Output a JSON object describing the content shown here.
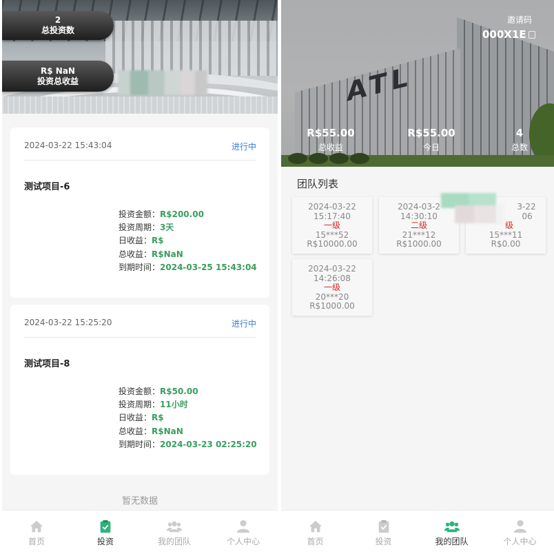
{
  "invest_screen": {
    "summary": {
      "count_value": "2",
      "count_label": "总投资数",
      "income_value": "R$ NaN",
      "income_label": "投资总收益"
    },
    "investments": [
      {
        "time": "2024-03-22 15:43:04",
        "status": "进行中",
        "title": "测试项目-6",
        "rows": [
          {
            "label": "投资金额：",
            "value": "R$200.00"
          },
          {
            "label": "投资周期：",
            "value": "3天"
          },
          {
            "label": "日收益：",
            "value": "R$"
          },
          {
            "label": "总收益：",
            "value": "R$NaN"
          },
          {
            "label": "到期时间：",
            "value": "2024-03-25 15:43:04"
          }
        ]
      },
      {
        "time": "2024-03-22 15:25:20",
        "status": "进行中",
        "title": "测试项目-8",
        "rows": [
          {
            "label": "投资金额：",
            "value": "R$50.00"
          },
          {
            "label": "投资周期：",
            "value": "11小时"
          },
          {
            "label": "日收益：",
            "value": "R$"
          },
          {
            "label": "总收益：",
            "value": "R$NaN"
          },
          {
            "label": "到期时间：",
            "value": "2024-03-23 02:25:20"
          }
        ]
      }
    ],
    "empty_text": "暂无数据"
  },
  "team_screen": {
    "invite": {
      "label": "邀请码",
      "code": "000X1E"
    },
    "stats": [
      {
        "value": "R$55.00",
        "label": "总收益"
      },
      {
        "value": "R$55.00",
        "label": "今日"
      },
      {
        "value": "4",
        "label": "总数"
      }
    ],
    "list_title": "团队列表",
    "members": [
      {
        "date": "2024-03-22",
        "time": "15:17:40",
        "level": "一级",
        "phone": "15***52",
        "amount": "R$10000.00"
      },
      {
        "date": "2024-03-2",
        "time": "14:30:10",
        "level": "二级",
        "phone": "21***12",
        "amount": "R$1000.00"
      },
      {
        "date": "3-22",
        "time": "06",
        "level": "级",
        "phone": "15***11",
        "amount": "R$0.00"
      },
      {
        "date": "2024-03-22",
        "time": "14:26:08",
        "level": "一级",
        "phone": "20***20",
        "amount": "R$1000.00"
      }
    ]
  },
  "tabbar": [
    {
      "label": "首页",
      "icon": "home-icon"
    },
    {
      "label": "投资",
      "icon": "clipboard-check-icon"
    },
    {
      "label": "我的团队",
      "icon": "team-icon"
    },
    {
      "label": "个人中心",
      "icon": "user-icon"
    }
  ],
  "colors": {
    "accent_green": "#3a9d5f",
    "active_tab_green": "#2fb37c",
    "status_blue": "#3a7bd5",
    "level_red": "#d62b2b",
    "inactive_gray": "#cccccc"
  }
}
